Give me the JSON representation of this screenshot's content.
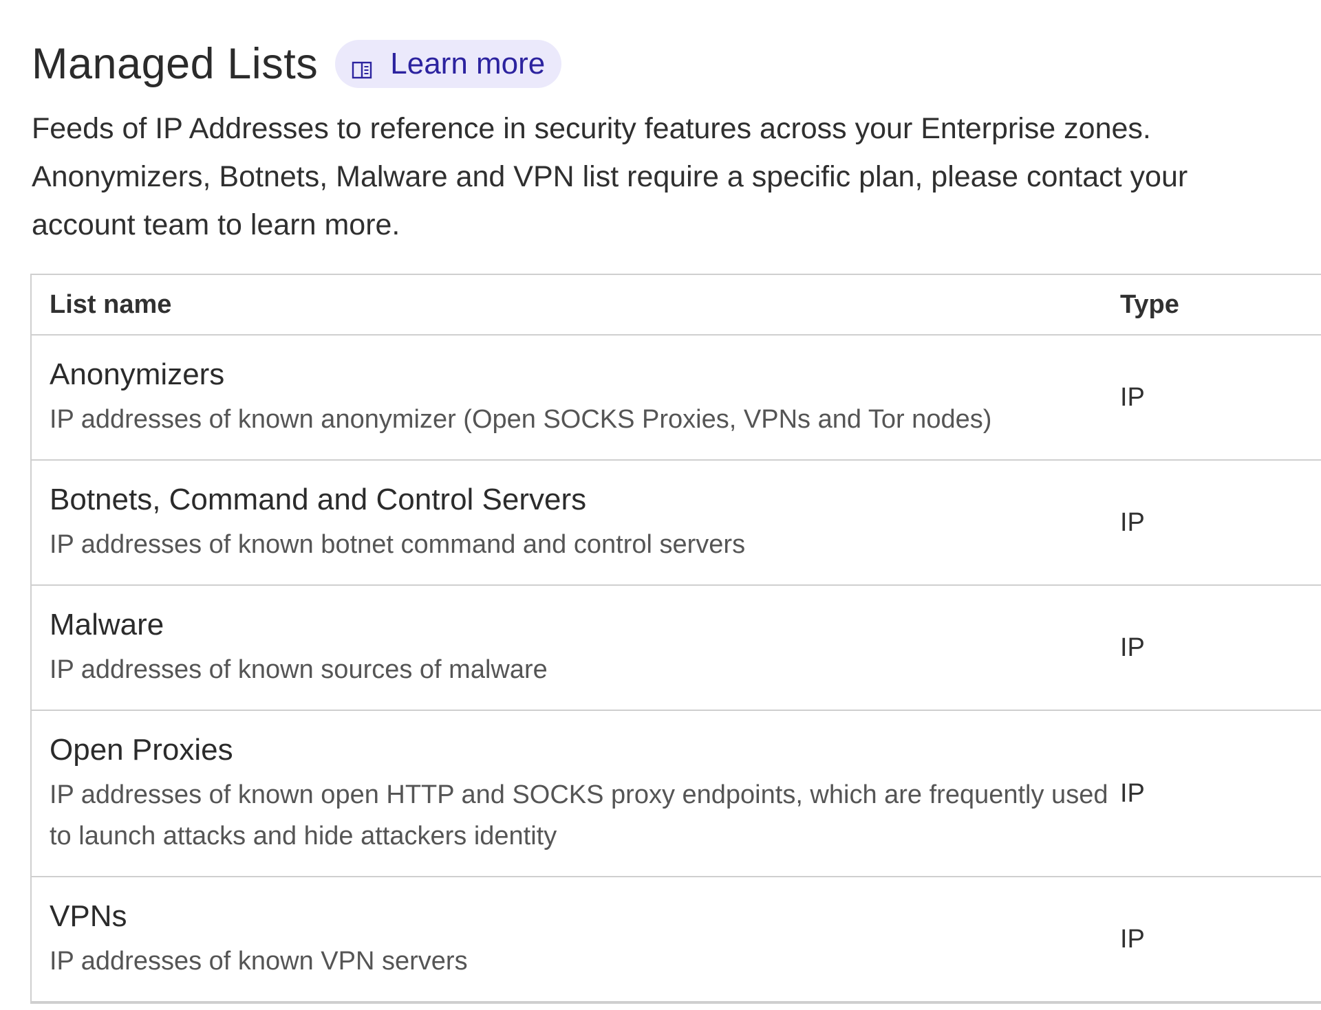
{
  "page": {
    "title": "Managed Lists",
    "learn_more_label": "Learn more",
    "learn_more_icon": "book-icon",
    "description": "Feeds of IP Addresses to reference in security features across your Enterprise zones. Anonymizers, Botnets, Malware and VPN list require a specific plan, please contact your account team to learn more."
  },
  "colors": {
    "accent": "#2c239f",
    "accent_bg": "#ebe9fb",
    "border": "#cfcfcf"
  },
  "table": {
    "headers": {
      "name": "List name",
      "type": "Type"
    },
    "rows": [
      {
        "name": "Anonymizers",
        "description": "IP addresses of known anonymizer (Open SOCKS Proxies, VPNs and Tor nodes)",
        "type": "IP"
      },
      {
        "name": "Botnets, Command and Control Servers",
        "description": "IP addresses of known botnet command and control servers",
        "type": "IP"
      },
      {
        "name": "Malware",
        "description": "IP addresses of known sources of malware",
        "type": "IP"
      },
      {
        "name": "Open Proxies",
        "description": "IP addresses of known open HTTP and SOCKS proxy endpoints, which are frequently used to launch attacks and hide attackers identity",
        "type": "IP"
      },
      {
        "name": "VPNs",
        "description": "IP addresses of known VPN servers",
        "type": "IP"
      }
    ]
  }
}
